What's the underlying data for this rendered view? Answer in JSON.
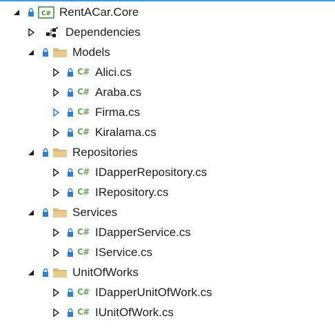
{
  "project": {
    "name": "RentACar.Core",
    "icon": "csharp-project-icon"
  },
  "dependencies": {
    "label": "Dependencies",
    "icon": "dependencies-icon"
  },
  "folders": [
    {
      "name": "Models",
      "icon": "folder-icon",
      "files": [
        "Alici.cs",
        "Araba.cs",
        "Firma.cs",
        "Kiralama.cs"
      ]
    },
    {
      "name": "Repositories",
      "icon": "folder-icon",
      "files": [
        "IDapperRepository.cs",
        "IRepository.cs"
      ]
    },
    {
      "name": "Services",
      "icon": "folder-icon",
      "files": [
        "IDapperService.cs",
        "IService.cs"
      ]
    },
    {
      "name": "UnitOfWorks",
      "icon": "folder-icon",
      "files": [
        "IDapperUnitOfWork.cs",
        "IUnitOfWork.cs"
      ]
    }
  ],
  "glyphs": {
    "csharp_file": "C#",
    "project_badge": "C#"
  },
  "colors": {
    "expand_arrow": "#1e1e1e",
    "collapsed_arrow_highlight": "#1e7fd8",
    "lock": "#2f7fd1",
    "csharp_file": "#68a85a",
    "folder": "#dcb67a",
    "project_badge": "#368832"
  }
}
